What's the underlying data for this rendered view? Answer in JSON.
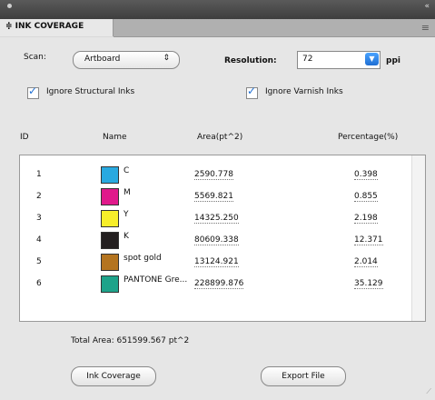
{
  "window": {
    "collapse_glyph": "«"
  },
  "tab": {
    "title": "≑ INK COVERAGE"
  },
  "panel_menu_glyph": "≡",
  "scan": {
    "label": "Scan:",
    "value": "Artboard",
    "arrows": "⇕"
  },
  "resolution": {
    "label": "Resolution:",
    "value": "72",
    "unit": "ppi"
  },
  "checks": {
    "structural": "Ignore Structural Inks",
    "varnish": "Ignore Varnish Inks"
  },
  "columns": {
    "id": "ID",
    "name": "Name",
    "area": "Area(pt^2)",
    "percentage": "Percentage(%)"
  },
  "rows": [
    {
      "id": "1",
      "name": "C",
      "area": "2590.778",
      "pct": "0.398",
      "color": "#29a9e0"
    },
    {
      "id": "2",
      "name": "M",
      "area": "5569.821",
      "pct": "0.855",
      "color": "#e0198b"
    },
    {
      "id": "3",
      "name": "Y",
      "area": "14325.250",
      "pct": "2.198",
      "color": "#f7ee2a"
    },
    {
      "id": "4",
      "name": "K",
      "area": "80609.338",
      "pct": "12.371",
      "color": "#231f20"
    },
    {
      "id": "5",
      "name": "spot gold",
      "area": "13124.921",
      "pct": "2.014",
      "color": "#b4741f"
    },
    {
      "id": "6",
      "name": "PANTONE Gre...",
      "area": "228899.876",
      "pct": "35.129",
      "color": "#1ea38a"
    }
  ],
  "total": "Total Area: 651599.567 pt^2",
  "buttons": {
    "ink_coverage": "Ink Coverage",
    "export": "Export File"
  }
}
